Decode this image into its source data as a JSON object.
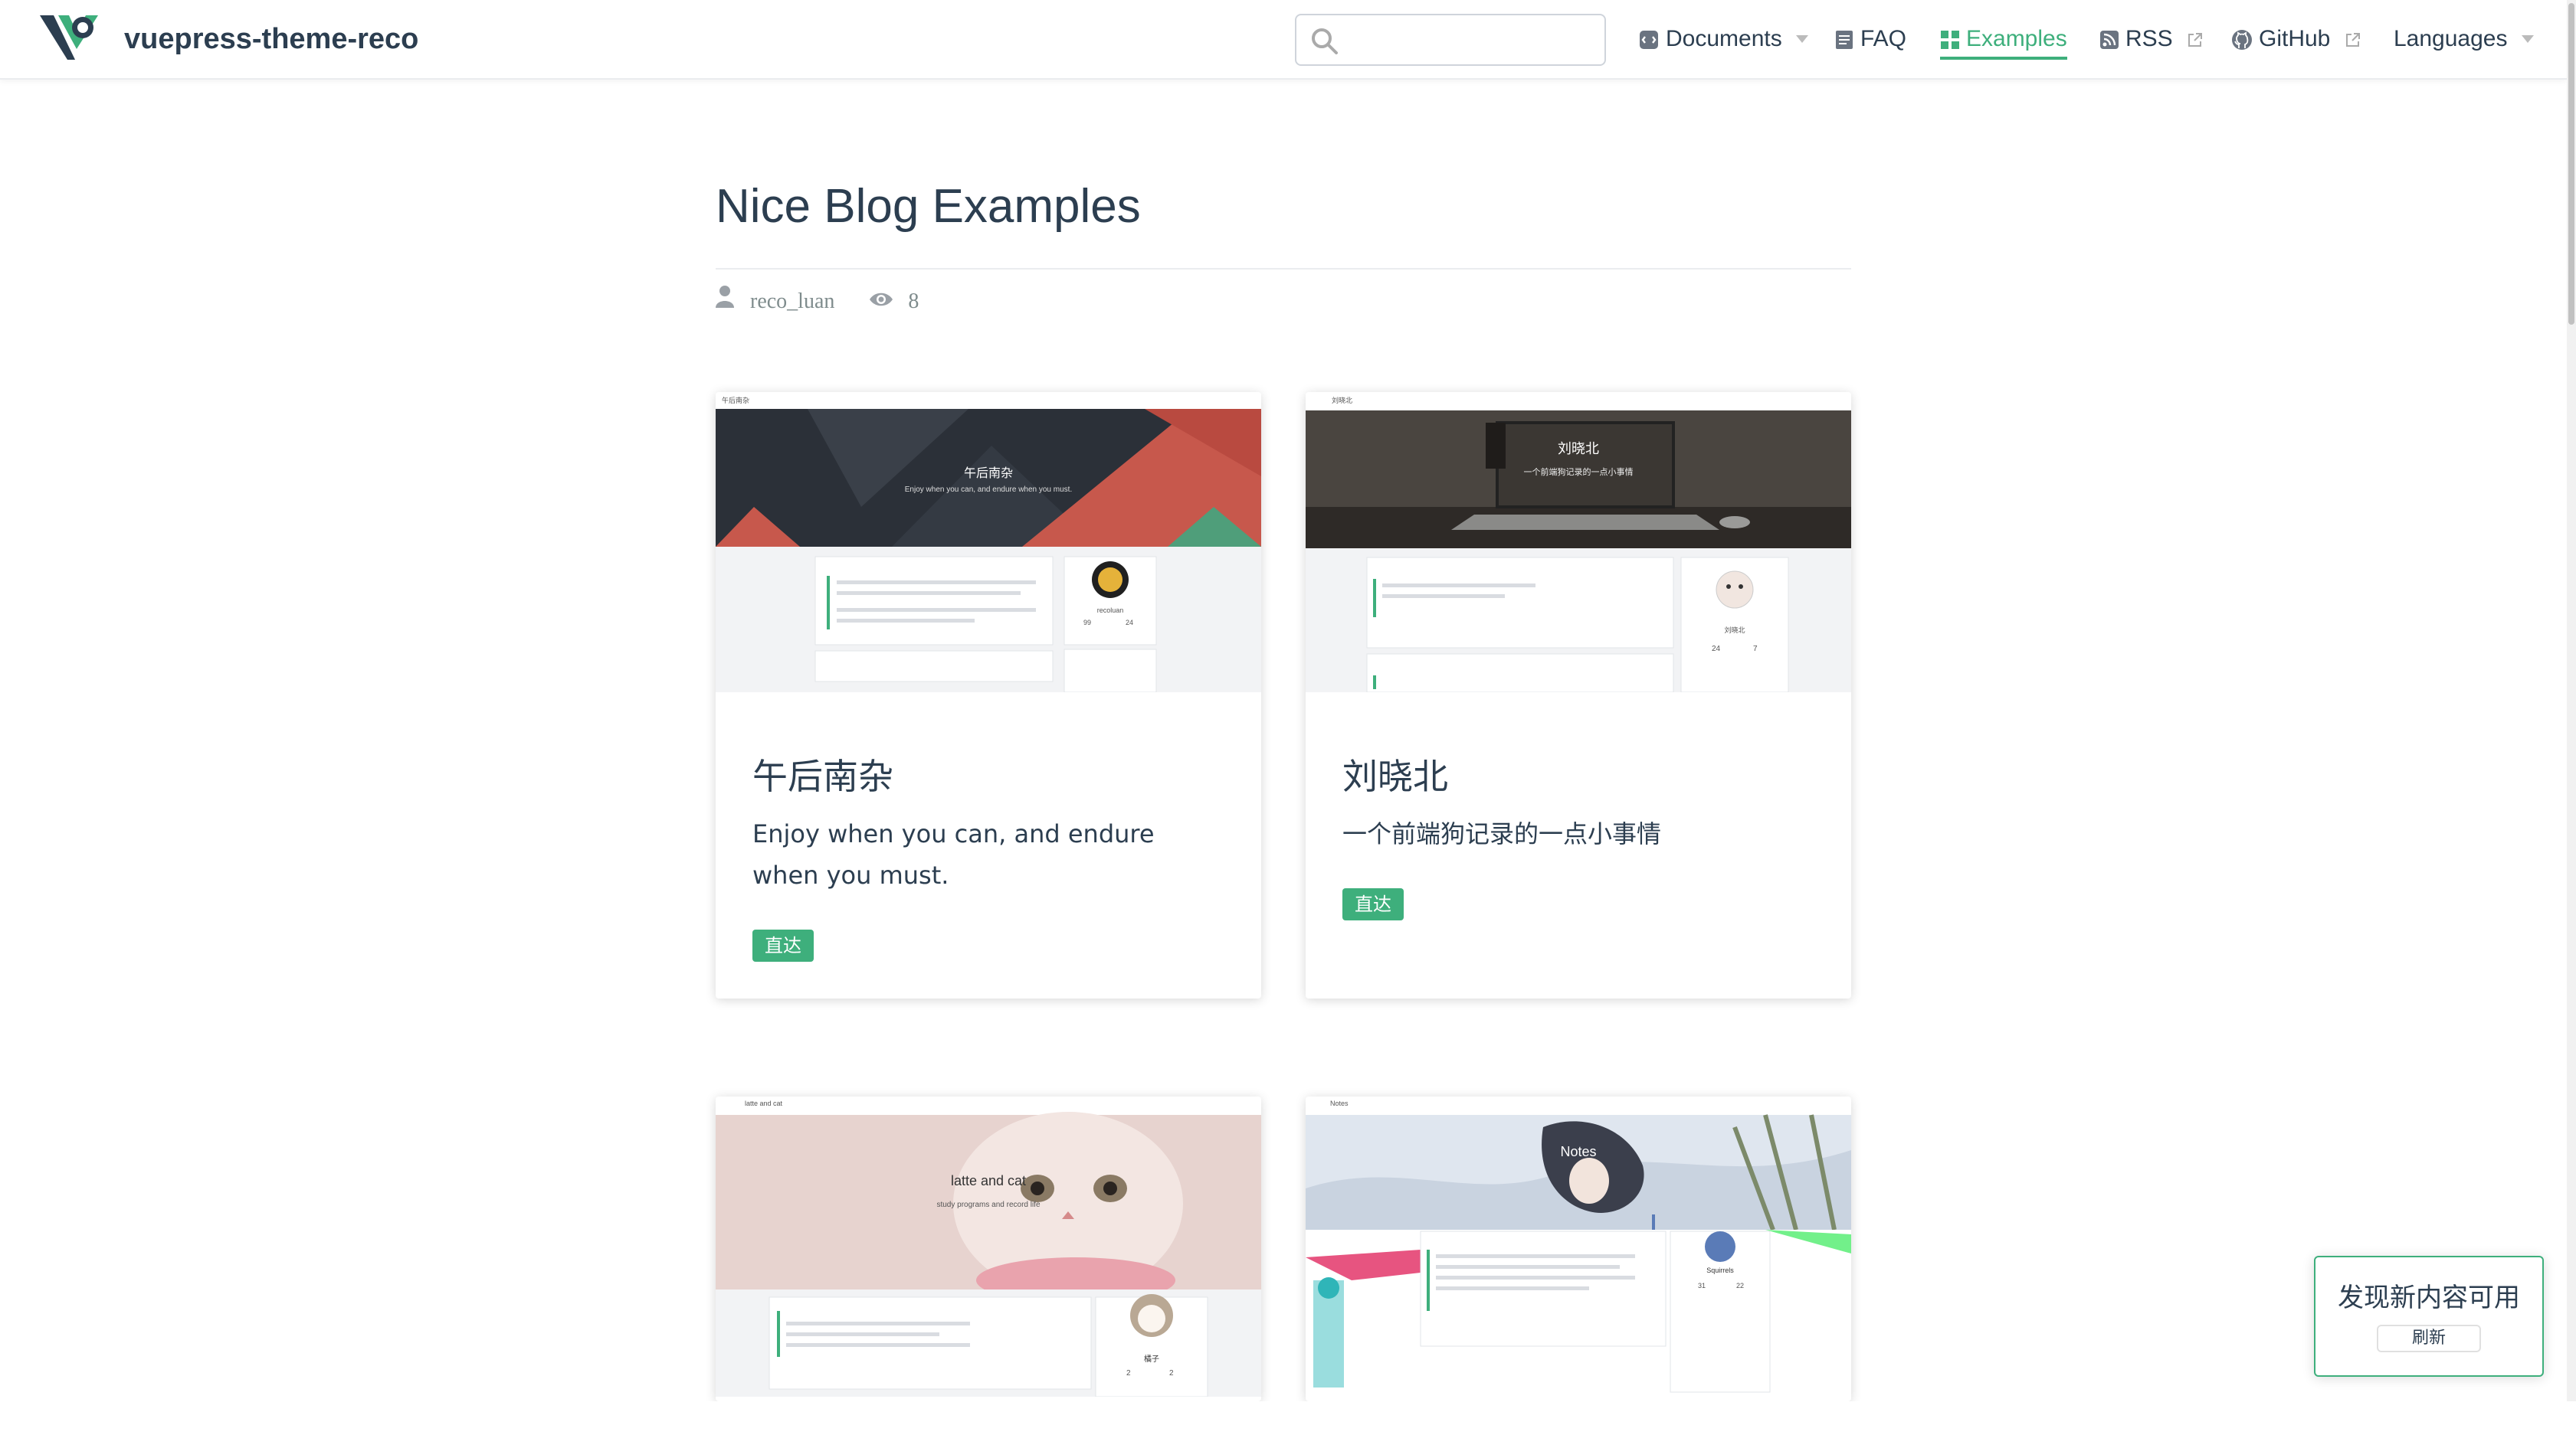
{
  "site": {
    "name": "vuepress-theme-reco"
  },
  "search": {
    "placeholder": ""
  },
  "nav": {
    "documents": "Documents",
    "faq": "FAQ",
    "examples": "Examples",
    "rss": "RSS",
    "github": "GitHub",
    "languages": "Languages"
  },
  "page": {
    "title": "Nice Blog Examples",
    "author": "reco_luan",
    "views": "8"
  },
  "cards": [
    {
      "title": "午后南杂",
      "desc": "Enjoy when you can, and endure when you must.",
      "button": "直达",
      "shot_title": "午后南杂",
      "shot_subtitle": "Enjoy when you can, and endure when you must.",
      "shot_site": "午后南杂",
      "shot_name": "recoluan",
      "shot_stat_a": "99",
      "shot_stat_b": "24"
    },
    {
      "title": "刘晓北",
      "desc": "一个前端狗记录的一点小事情",
      "button": "直达",
      "shot_title": "刘晓北",
      "shot_subtitle": "一个前端狗记录的一点小事情",
      "shot_site": "刘晓北",
      "shot_name": "刘晓北",
      "shot_stat_a": "24",
      "shot_stat_b": "7"
    },
    {
      "shot_title": "latte and cat",
      "shot_subtitle": "study programs and record life",
      "shot_site": "latte and cat",
      "shot_name": "橘子",
      "shot_stat_a": "2",
      "shot_stat_b": "2"
    },
    {
      "shot_title": "Notes",
      "shot_site": "Notes",
      "shot_name": "Squirrels",
      "shot_stat_a": "31",
      "shot_stat_b": "22"
    }
  ],
  "toast": {
    "message": "发现新内容可用",
    "refresh": "刷新"
  },
  "colors": {
    "accent": "#3eaf7c",
    "text": "#2c3e50",
    "muted": "#7f8c8d"
  }
}
